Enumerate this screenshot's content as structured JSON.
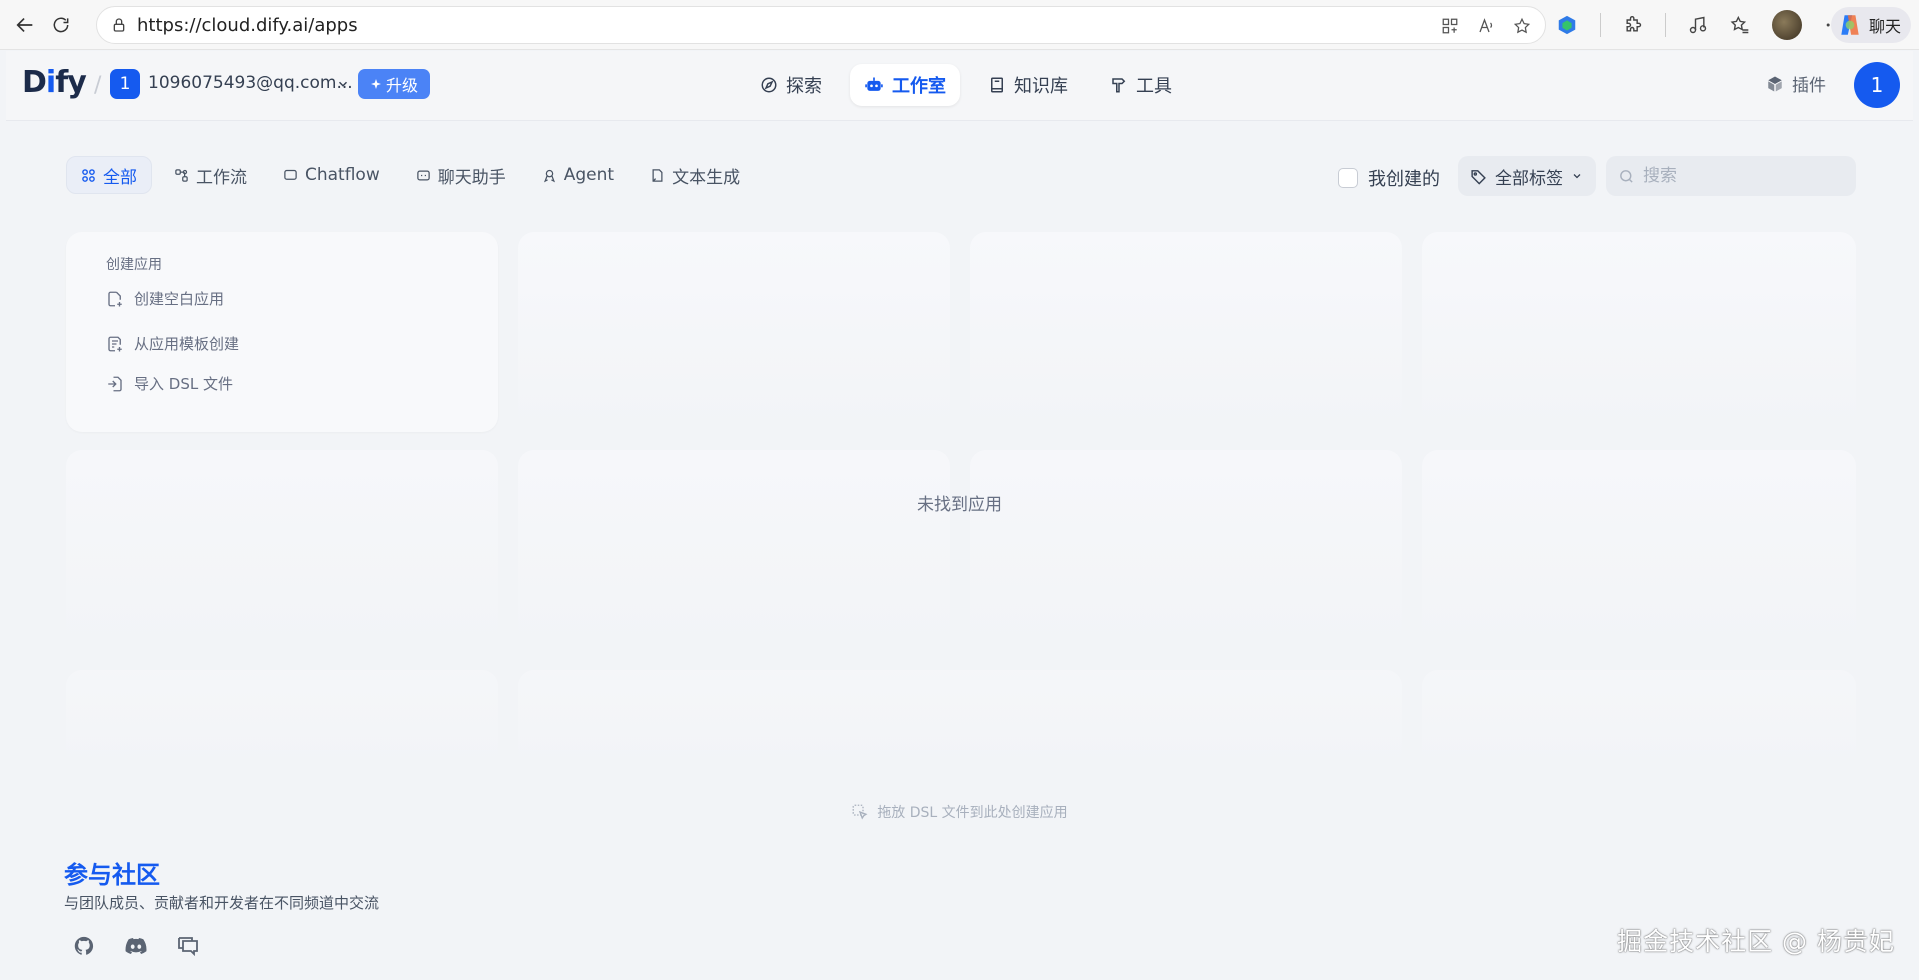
{
  "browser": {
    "url": "https://cloud.dify.ai/apps",
    "chat_label": "聊天"
  },
  "header": {
    "logo": {
      "d": "D",
      "i": "i",
      "rest": "fy"
    },
    "workspace_badge": "1",
    "workspace_name": "1096075493@qq.com...",
    "upgrade_label": "升级",
    "nav": [
      {
        "label": "探索",
        "icon": "compass-icon"
      },
      {
        "label": "工作室",
        "icon": "robot-icon",
        "active": true
      },
      {
        "label": "知识库",
        "icon": "book-icon"
      },
      {
        "label": "工具",
        "icon": "hammer-icon"
      }
    ],
    "plugins_label": "插件",
    "avatar_initial": "1"
  },
  "filters": {
    "tabs": [
      {
        "label": "全部",
        "icon": "grid-icon",
        "active": true
      },
      {
        "label": "工作流",
        "icon": "workflow-icon"
      },
      {
        "label": "Chatflow",
        "icon": "chatflow-icon"
      },
      {
        "label": "聊天助手",
        "icon": "chatbot-icon"
      },
      {
        "label": "Agent",
        "icon": "agent-icon"
      },
      {
        "label": "文本生成",
        "icon": "text-generation-icon"
      }
    ],
    "created_by_me": "我创建的",
    "tags_label": "全部标签",
    "search_placeholder": "搜索"
  },
  "create_card": {
    "title": "创建应用",
    "items": [
      {
        "label": "创建空白应用",
        "icon": "blank-app-icon"
      },
      {
        "label": "从应用模板创建",
        "icon": "template-icon"
      },
      {
        "label": "导入 DSL 文件",
        "icon": "import-icon"
      }
    ]
  },
  "empty_message": "未找到应用",
  "drop_hint": "拖放 DSL 文件到此处创建应用",
  "community": {
    "title": "参与社区",
    "description": "与团队成员、贡献者和开发者在不同频道中交流"
  },
  "watermark": "掘金技术社区 @ 杨贵妃"
}
